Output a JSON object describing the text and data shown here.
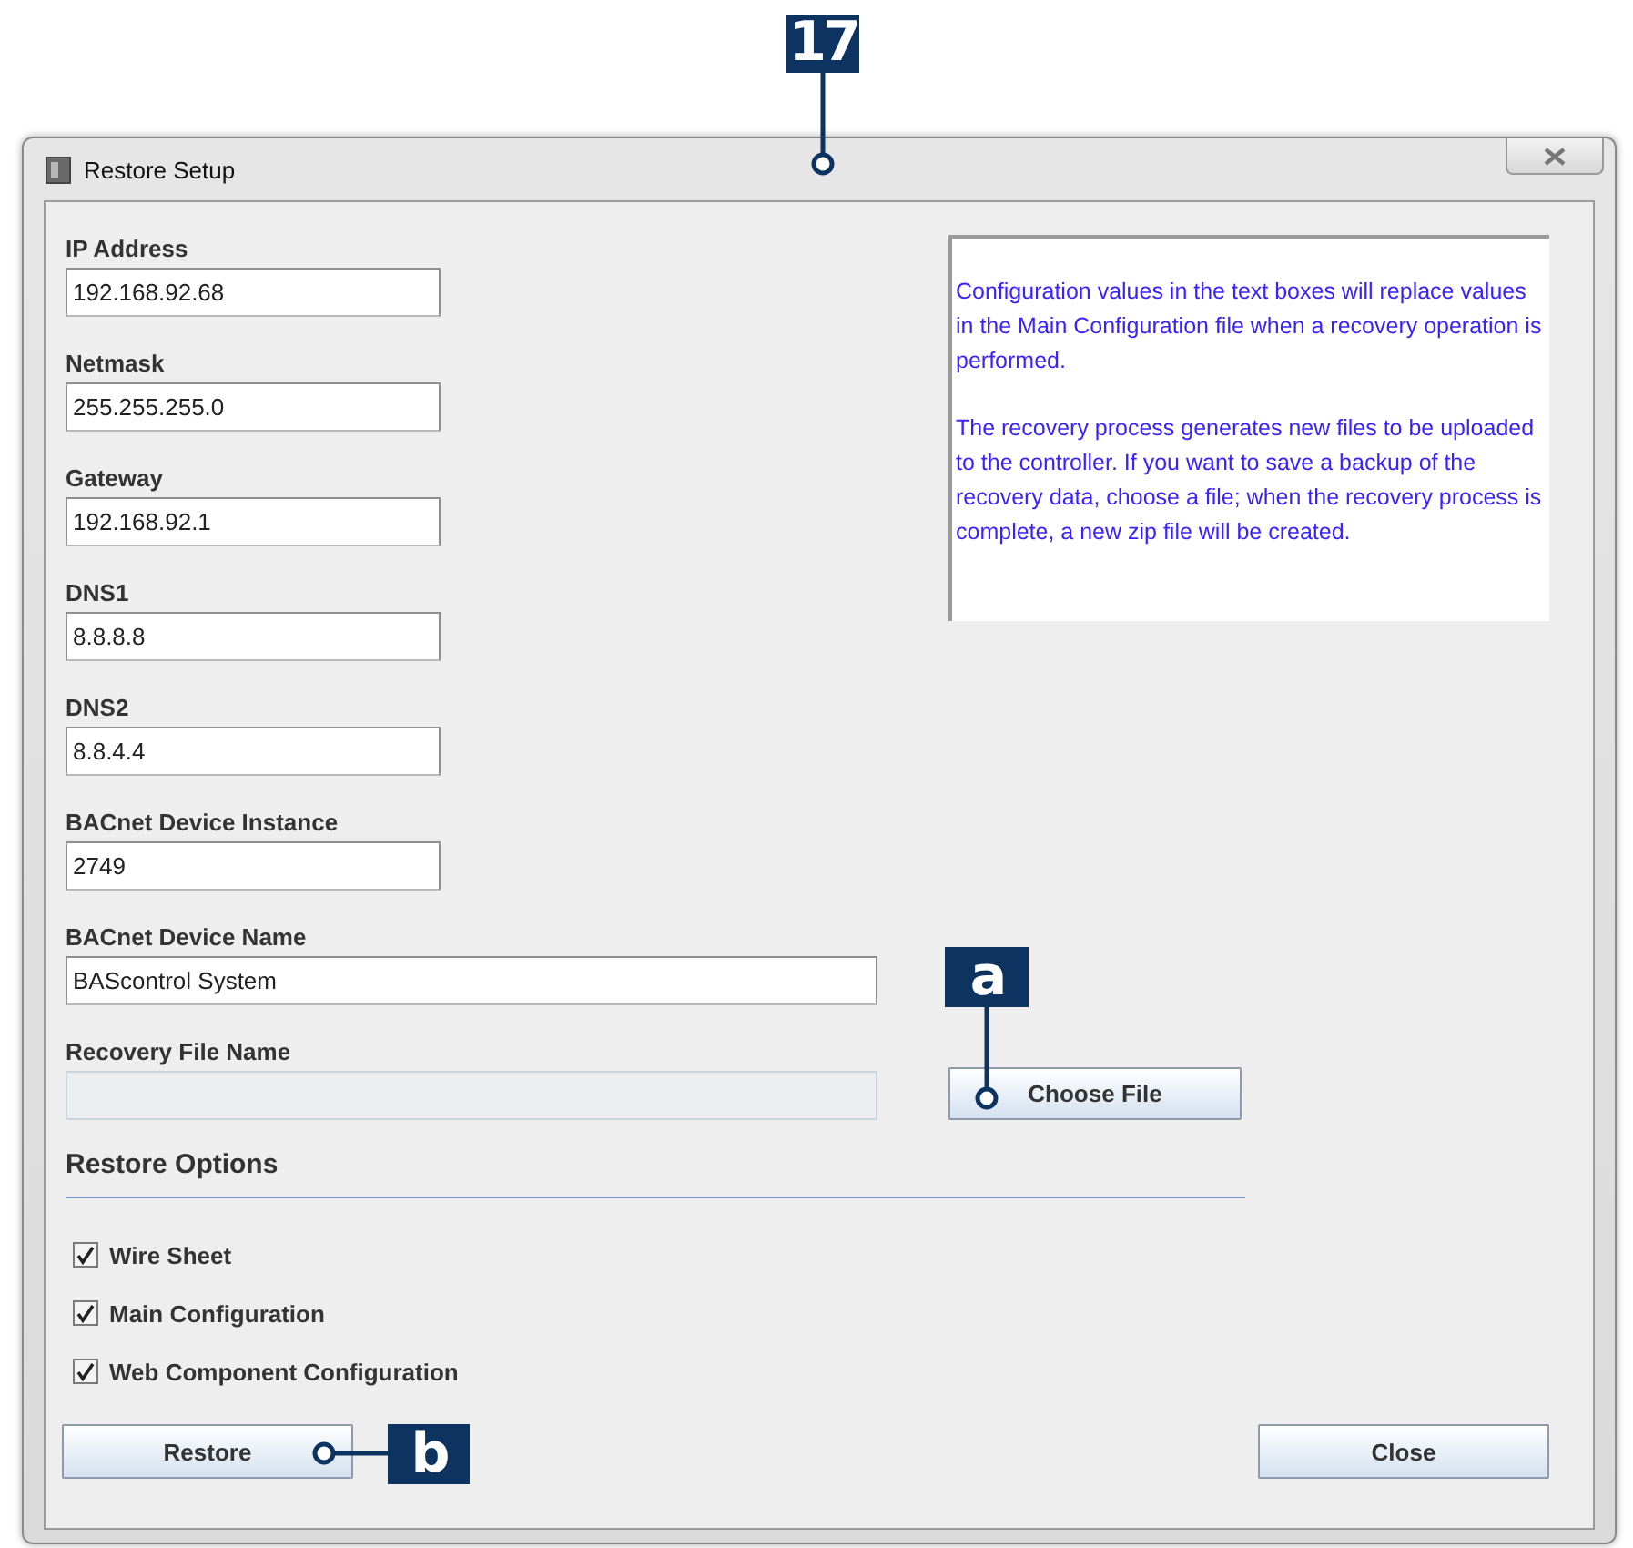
{
  "window": {
    "title": "Restore Setup"
  },
  "fields": [
    {
      "label": "IP Address",
      "value": "192.168.92.68",
      "kind": "short",
      "disabled": false
    },
    {
      "label": "Netmask",
      "value": "255.255.255.0",
      "kind": "short",
      "disabled": false
    },
    {
      "label": "Gateway",
      "value": "192.168.92.1",
      "kind": "short",
      "disabled": false
    },
    {
      "label": "DNS1",
      "value": "8.8.8.8",
      "kind": "short",
      "disabled": false
    },
    {
      "label": "DNS2",
      "value": "8.8.4.4",
      "kind": "short",
      "disabled": false
    },
    {
      "label": "BACnet Device Instance",
      "value": "2749",
      "kind": "short",
      "disabled": false
    },
    {
      "label": "BACnet Device Name",
      "value": "BAScontrol System",
      "kind": "wide",
      "disabled": false
    }
  ],
  "recovery_file": {
    "label": "Recovery File Name",
    "disabled": true,
    "button": "Choose File"
  },
  "info": [
    "Configuration values in the text boxes will replace values in the Main Configuration file when a recovery operation is performed.",
    "The recovery process generates new files to be uploaded to the controller. If you want to save a backup of the recovery data, choose a file; when the recovery process is complete, a new zip file will be created."
  ],
  "restore_options": {
    "heading": "Restore Options",
    "items": [
      {
        "label": "Wire Sheet",
        "checked": true
      },
      {
        "label": "Main Configuration",
        "checked": true
      },
      {
        "label": "Web Component Configuration",
        "checked": true
      }
    ]
  },
  "buttons": [
    "Restore",
    "Close"
  ],
  "callouts": [
    {
      "label": "17"
    },
    {
      "label": "a"
    },
    {
      "label": "b"
    }
  ]
}
